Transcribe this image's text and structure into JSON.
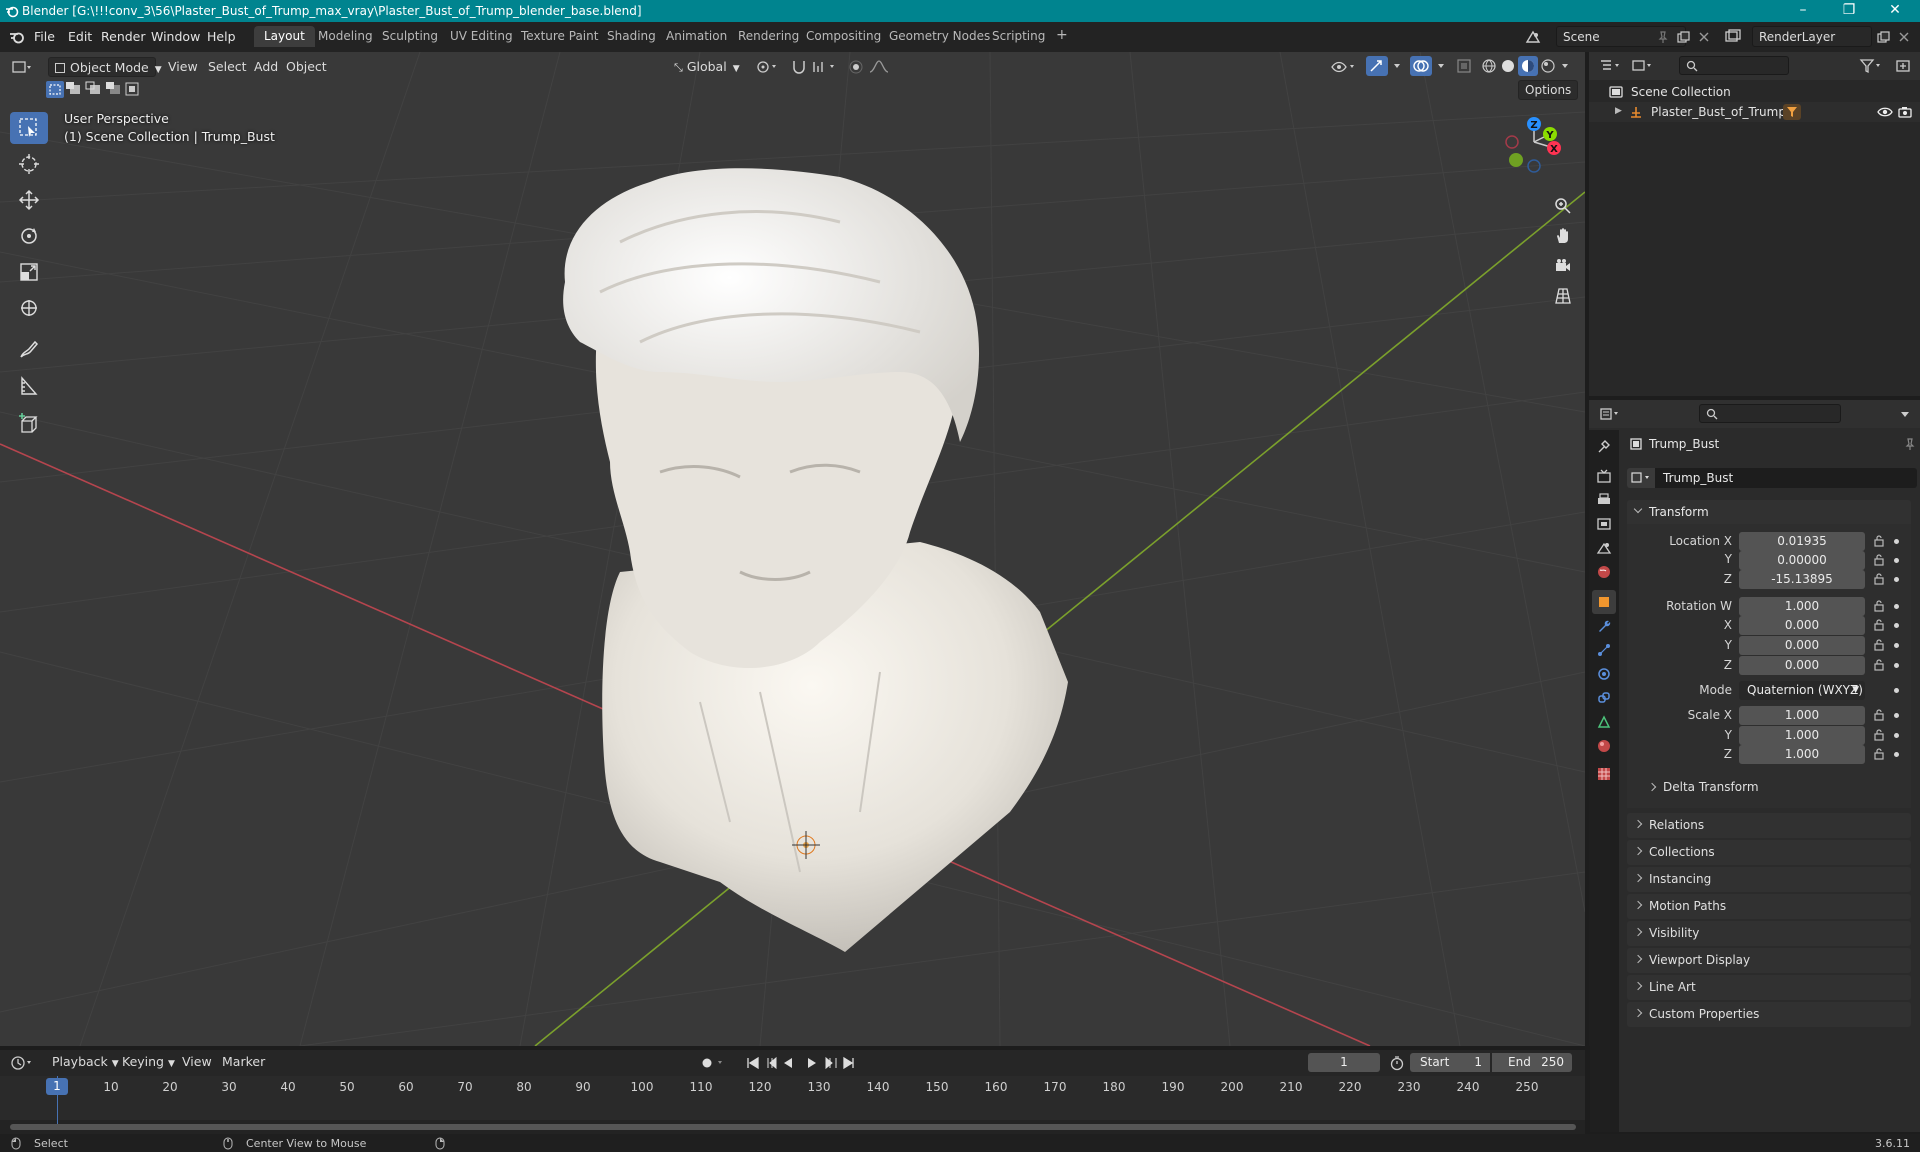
{
  "window": {
    "title": "Blender [G:\\!!!conv_3\\56\\Plaster_Bust_of_Trump_max_vray\\Plaster_Bust_of_Trump_blender_base.blend]",
    "controls": [
      "–",
      "❐",
      "✕"
    ]
  },
  "menu": [
    "File",
    "Edit",
    "Render",
    "Window",
    "Help"
  ],
  "workspaces": {
    "active": "Layout",
    "tabs": [
      "Layout",
      "Modeling",
      "Sculpting",
      "UV Editing",
      "Texture Paint",
      "Shading",
      "Animation",
      "Rendering",
      "Compositing",
      "Geometry Nodes",
      "Scripting"
    ],
    "add": "+"
  },
  "scene": {
    "name": "Scene",
    "render_layer": "RenderLayer"
  },
  "viewport": {
    "mode": "Object Mode",
    "menus": [
      "View",
      "Select",
      "Add",
      "Object"
    ],
    "orientation": "Global",
    "options_label": "Options",
    "info_line1": "User Perspective",
    "info_line2": "(1) Scene Collection | Trump_Bust",
    "gizmo_axes": {
      "x": "X",
      "y": "Y",
      "z": "Z"
    },
    "axis_colors": {
      "x": "#ff3352",
      "y": "#8bdc00",
      "z": "#2890ff"
    }
  },
  "outliner": {
    "root": "Scene Collection",
    "items": [
      {
        "label": "Plaster_Bust_of_Trump"
      }
    ]
  },
  "properties": {
    "object_name": "Trump_Bust",
    "data_name": "Trump_Bust",
    "transform": {
      "header": "Transform",
      "location_label": "Location X",
      "location": [
        "0.01935",
        "0.00000",
        "-15.13895"
      ],
      "rotation_label": "Rotation W",
      "rotation": [
        "1.000",
        "0.000",
        "0.000",
        "0.000"
      ],
      "mode_label": "Mode",
      "mode_value": "Quaternion (WXYZ)",
      "scale_label": "Scale X",
      "scale": [
        "1.000",
        "1.000",
        "1.000"
      ],
      "axis_labels": [
        "X",
        "Y",
        "Z"
      ],
      "delta": "Delta Transform"
    },
    "panels": [
      "Relations",
      "Collections",
      "Instancing",
      "Motion Paths",
      "Visibility",
      "Viewport Display",
      "Line Art",
      "Custom Properties"
    ]
  },
  "timeline": {
    "menus": [
      "Playback",
      "Keying",
      "View",
      "Marker"
    ],
    "current_frame": "1",
    "start_label": "Start",
    "start": "1",
    "end_label": "End",
    "end": "250",
    "ruler": [
      "10",
      "20",
      "30",
      "40",
      "50",
      "60",
      "70",
      "80",
      "90",
      "100",
      "110",
      "120",
      "130",
      "140",
      "150",
      "160",
      "170",
      "180",
      "190",
      "200",
      "210",
      "220",
      "230",
      "240",
      "250"
    ],
    "playhead": "1"
  },
  "statusbar": {
    "left": "Select",
    "middle": "Center View to Mouse",
    "version": "3.6.11"
  }
}
